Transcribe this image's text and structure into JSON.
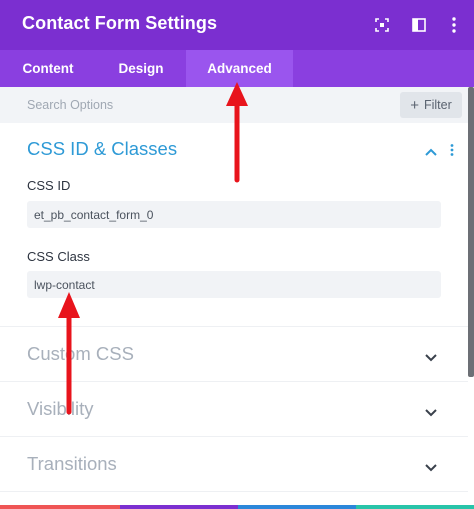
{
  "header": {
    "title": "Contact Form Settings",
    "icons": [
      "expand-icon",
      "split-view-icon",
      "more-icon"
    ]
  },
  "tabs": [
    {
      "label": "Content",
      "active": false
    },
    {
      "label": "Design",
      "active": false
    },
    {
      "label": "Advanced",
      "active": true
    }
  ],
  "search": {
    "placeholder": "Search Options",
    "filter_label": "Filter"
  },
  "sections": {
    "css_id_classes": {
      "title": "CSS ID & Classes",
      "expanded": true,
      "fields": [
        {
          "label": "CSS ID",
          "value": "et_pb_contact_form_0"
        },
        {
          "label": "CSS Class",
          "value": "lwp-contact"
        }
      ]
    },
    "collapsed": [
      {
        "title": "Custom CSS"
      },
      {
        "title": "Visibility"
      },
      {
        "title": "Transitions"
      }
    ]
  },
  "colors": {
    "header_bg": "#7b2fd0",
    "tabs_bg": "#8a3fe0",
    "active_tab_bg": "#9a55ee",
    "section_open_title": "#2e9ad6",
    "annotation_arrow": "#e8141c"
  }
}
